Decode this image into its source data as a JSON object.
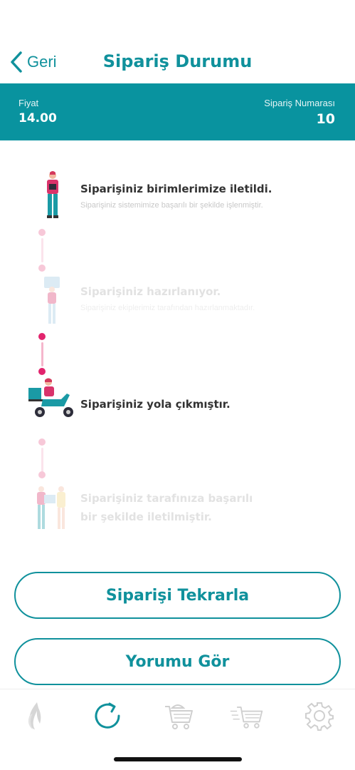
{
  "nav": {
    "back_label": "Geri",
    "title": "Sipariş Durumu"
  },
  "info": {
    "price_label": "Fiyat",
    "price_value": "14.00",
    "order_number_label": "Sipariş Numarası",
    "order_number_value": "10"
  },
  "steps": [
    {
      "title": "Siparişiniz birimlerimize iletildi.",
      "description": "Siparişiniz sistemimize başarılı bir şekilde işlenmiştir.",
      "status": "active"
    },
    {
      "title": "Siparişiniz hazırlanıyor.",
      "description": "Siparişiniz ekiplerimiz tarafından hazırlanmaktadır.",
      "status": "inactive"
    },
    {
      "title": "Siparişiniz yola çıkmıştır.",
      "description": "",
      "status": "active"
    },
    {
      "title_line1": "Siparişiniz tarafınıza başarılı",
      "title_line2": "bir şekilde iletilmiştir.",
      "status": "inactive"
    }
  ],
  "buttons": {
    "reorder_label": "Siparişi Tekrarla",
    "view_review_label": "Yorumu Gör"
  },
  "tabbar": {
    "items": [
      "flame-logo-icon",
      "refresh-icon",
      "food-cart-icon",
      "fast-cart-icon",
      "gear-icon"
    ],
    "active_index": 1
  },
  "colors": {
    "primary": "#10919c",
    "info_bar": "#09939f",
    "dot_active": "#e2246d",
    "dot_inactive": "#f7c8d8"
  }
}
